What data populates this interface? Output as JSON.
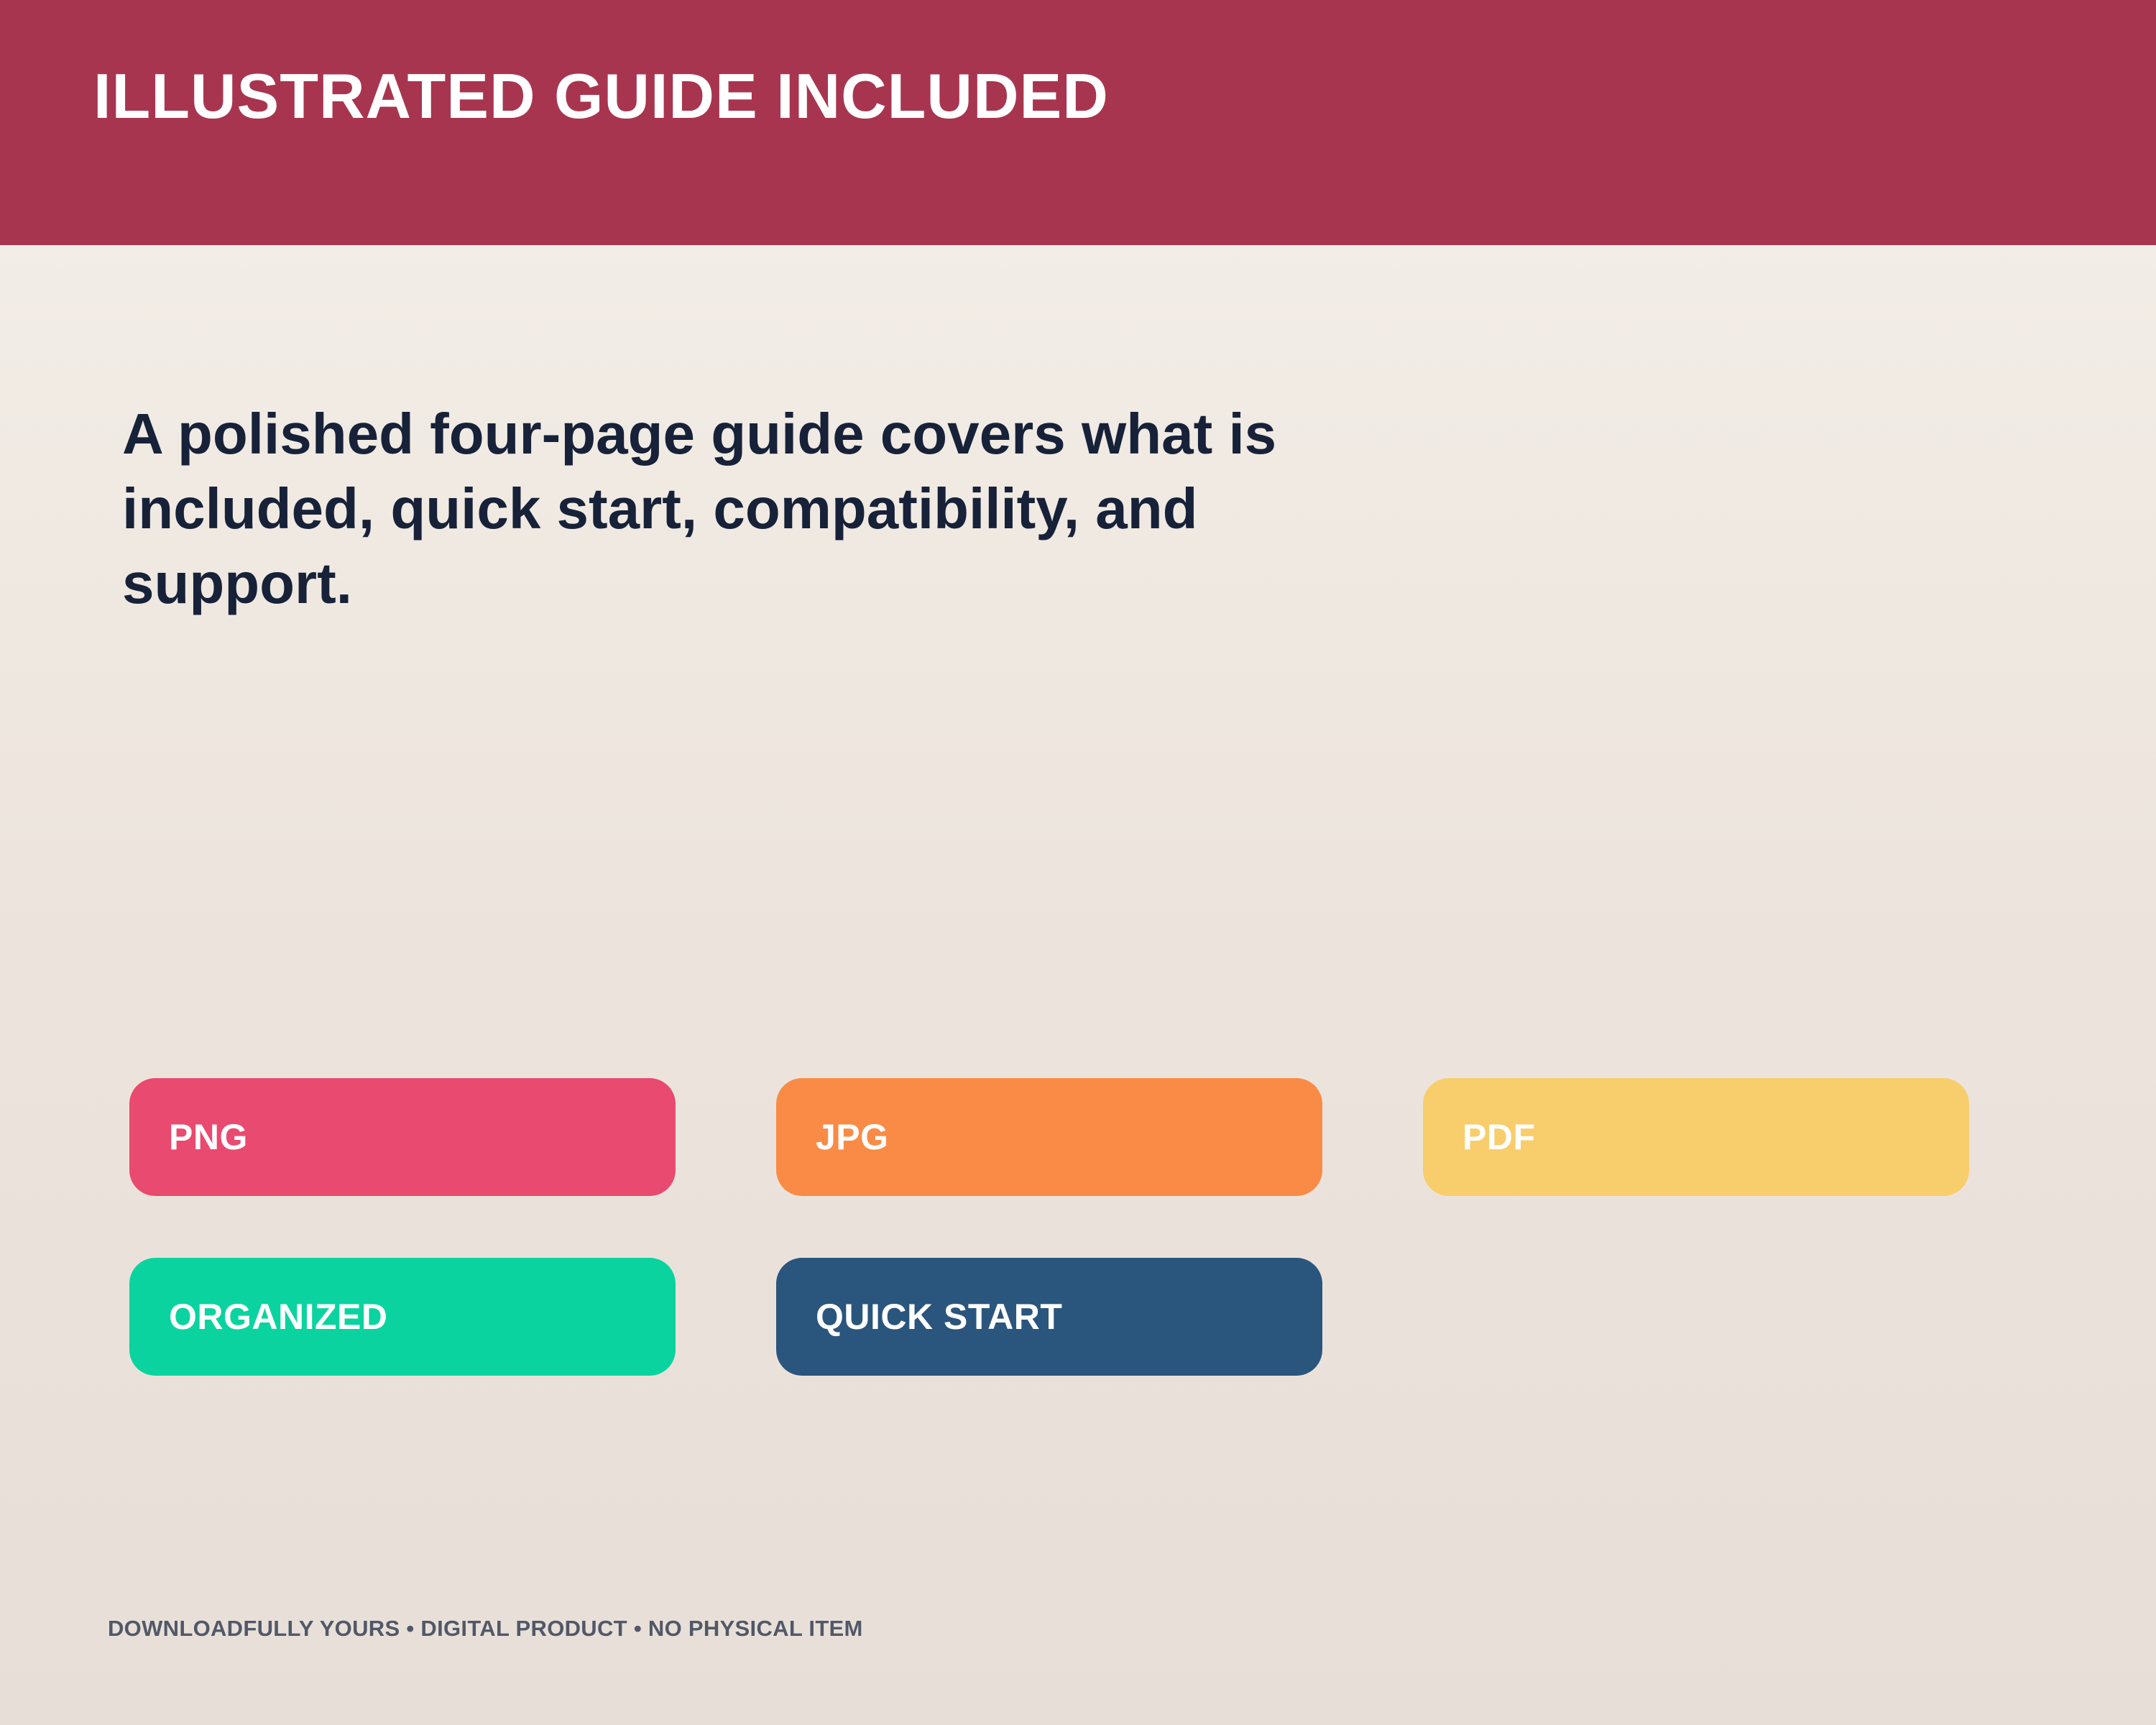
{
  "header": {
    "title": "ILLUSTRATED GUIDE INCLUDED",
    "background": "#a8354f"
  },
  "main": {
    "headline": "A polished four-page guide covers what is included, quick start, compatibility, and support."
  },
  "tags": [
    {
      "label": "PNG",
      "color": "#e94a6f"
    },
    {
      "label": "JPG",
      "color": "#f98b46"
    },
    {
      "label": "PDF",
      "color": "#f8cd6b"
    },
    {
      "label": "ORGANIZED",
      "color": "#0bd39f"
    },
    {
      "label": "QUICK START",
      "color": "#2a557d"
    }
  ],
  "footer": {
    "text": "DOWNLOADFULLY YOURS • DIGITAL PRODUCT • NO PHYSICAL ITEM"
  },
  "colors": {
    "headline_text": "#172239",
    "footer_text": "#515868",
    "background_top": "#f4f0ea",
    "background_bottom": "#e7dfd7"
  }
}
